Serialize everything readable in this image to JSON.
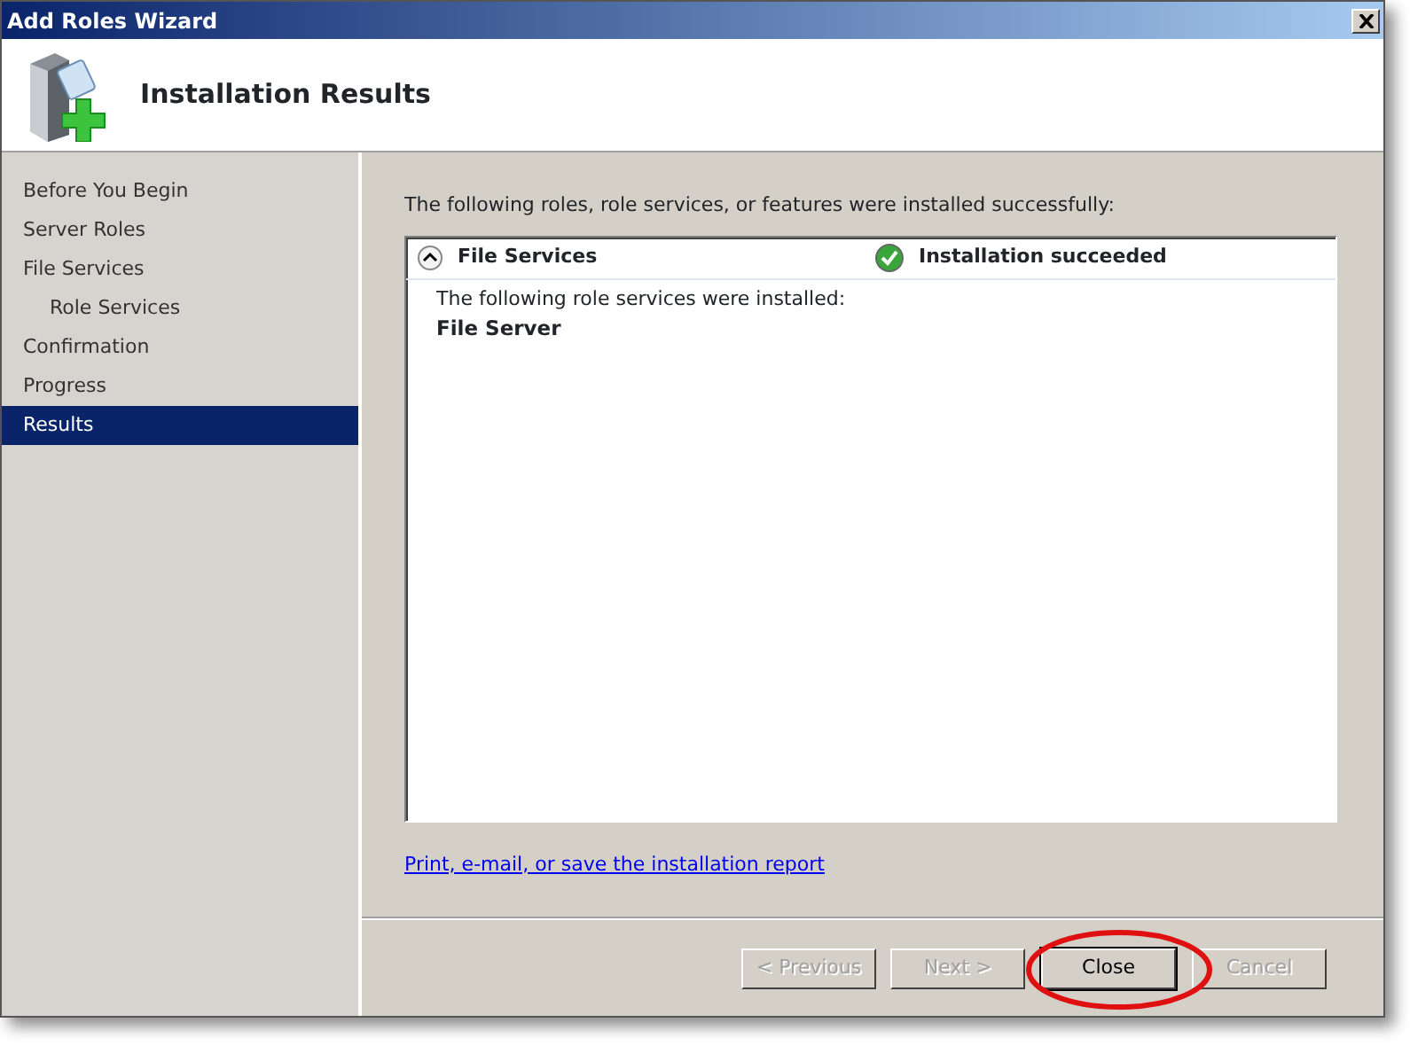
{
  "window": {
    "title": "Add Roles Wizard"
  },
  "header": {
    "title": "Installation Results"
  },
  "sidebar": {
    "items": [
      {
        "label": "Before You Begin",
        "selected": false
      },
      {
        "label": "Server Roles",
        "selected": false
      },
      {
        "label": "File Services",
        "selected": false,
        "children": [
          {
            "label": "Role Services",
            "selected": false
          }
        ]
      },
      {
        "label": "Confirmation",
        "selected": false
      },
      {
        "label": "Progress",
        "selected": false
      },
      {
        "label": "Results",
        "selected": true
      }
    ]
  },
  "intro": "The following roles, role services, or features were installed successfully:",
  "results": [
    {
      "name": "File Services",
      "expanded": true,
      "status": "Installation succeeded",
      "detail": "The following role services were installed:",
      "items": [
        "File Server"
      ]
    }
  ],
  "report_link": "Print, e-mail, or save the installation report",
  "buttons": [
    {
      "label": "< Previous",
      "disabled": true,
      "default": false
    },
    {
      "label": "Next >",
      "disabled": true,
      "default": false
    },
    {
      "label": "Close",
      "disabled": false,
      "default": true,
      "highlighted": true
    },
    {
      "label": "Cancel",
      "disabled": true,
      "default": false
    }
  ]
}
